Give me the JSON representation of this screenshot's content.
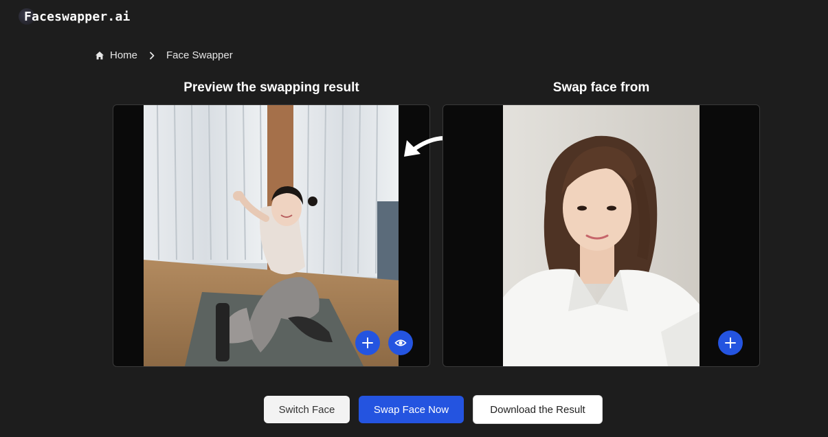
{
  "header": {
    "logo_text": "Faceswapper.ai",
    "logo_icon": "logo-mark-icon"
  },
  "breadcrumb": {
    "home_label": "Home",
    "current_label": "Face Swapper",
    "home_icon": "home-icon",
    "separator_icon": "chevron-right-icon"
  },
  "panels": {
    "left": {
      "title": "Preview the swapping result",
      "add_icon": "plus-icon",
      "view_icon": "eye-icon"
    },
    "right": {
      "title": "Swap face from",
      "add_icon": "plus-icon"
    }
  },
  "arrow_icon": "curved-arrow-left-icon",
  "actions": {
    "switch_label": "Switch Face",
    "swap_label": "Swap Face Now",
    "download_label": "Download the Result"
  },
  "colors": {
    "background": "#1d1d1d",
    "accent": "#2454e0",
    "panel": "#0a0a0a"
  }
}
